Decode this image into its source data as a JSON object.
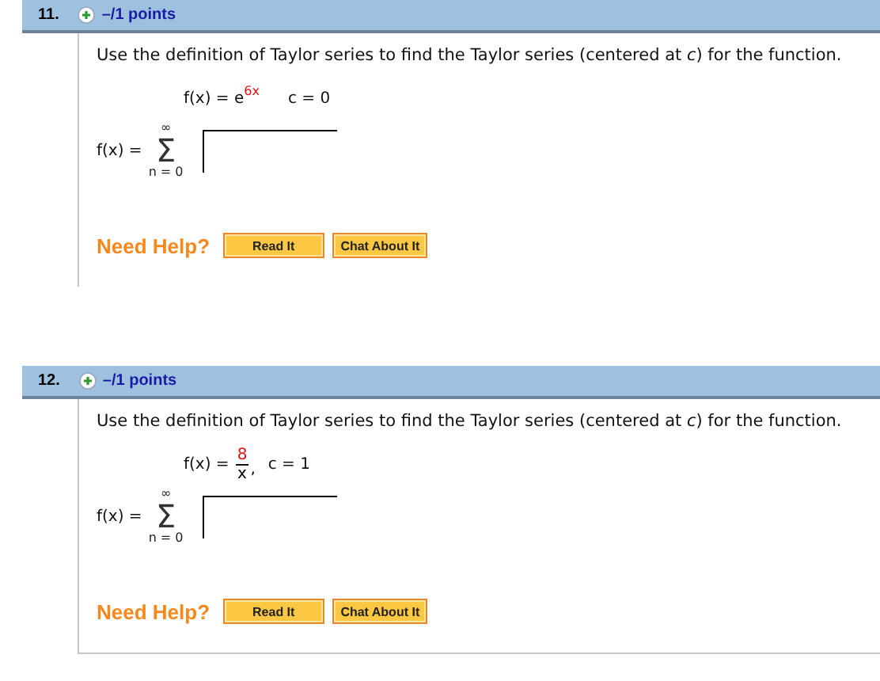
{
  "questions": [
    {
      "number": "11.",
      "points": "–/1 points",
      "prompt": "Use the definition of Taylor series to find the Taylor series (centered at *c*) for the function.",
      "formula": {
        "kind": "exponential",
        "lhs": "f(x) =",
        "base": "e",
        "exponent": "6x",
        "center": "c = 0"
      },
      "answer": {
        "lhs": "f(x) =",
        "upper": "∞",
        "sigma": "Σ",
        "lower": "n = 0"
      },
      "help": {
        "label": "Need Help?",
        "buttons": [
          "Read It",
          "Chat About It"
        ]
      }
    },
    {
      "number": "12.",
      "points": "–/1 points",
      "prompt": "Use the definition of Taylor series to find the Taylor series (centered at *c*) for the function.",
      "formula": {
        "kind": "fraction",
        "lhs": "f(x) =",
        "numerator": "8",
        "denominator": "x",
        "comma": ",",
        "center": "c = 1"
      },
      "answer": {
        "lhs": "f(x) =",
        "upper": "∞",
        "sigma": "Σ",
        "lower": "n = 0"
      },
      "help": {
        "label": "Need Help?",
        "buttons": [
          "Read It",
          "Chat About It"
        ]
      }
    }
  ]
}
